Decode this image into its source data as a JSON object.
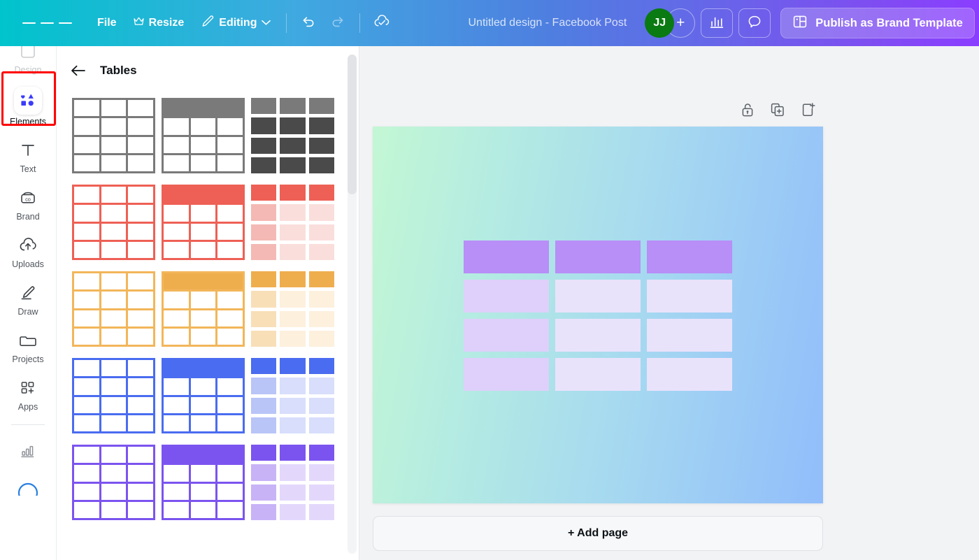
{
  "topbar": {
    "menu_icon": "hamburger-icon",
    "file_label": "File",
    "resize_label": "Resize",
    "resize_icon": "crown-icon",
    "editing_label": "Editing",
    "editing_icon": "pencil-icon",
    "chevron_icon": "chevron-down-icon",
    "undo_icon": "undo-icon",
    "redo_icon": "redo-icon",
    "cloud_icon": "cloud-check-icon",
    "doc_title": "Untitled design - Facebook Post",
    "avatar_initials": "JJ",
    "avatar_color": "#0a7a12",
    "add_collaborator_label": "+",
    "insights_icon": "bar-chart-icon",
    "comment_icon": "comment-bubble-icon",
    "publish_icon": "brand-template-icon",
    "publish_label": "Publish as Brand Template"
  },
  "rail": {
    "items": [
      {
        "label": "Design",
        "icon": "design-icon",
        "active": false,
        "cut": true
      },
      {
        "label": "Elements",
        "icon": "elements-icon",
        "active": true,
        "highlighted": true
      },
      {
        "label": "Text",
        "icon": "text-icon",
        "active": false
      },
      {
        "label": "Brand",
        "icon": "brand-icon",
        "active": false
      },
      {
        "label": "Uploads",
        "icon": "uploads-icon",
        "active": false
      },
      {
        "label": "Draw",
        "icon": "draw-icon",
        "active": false
      },
      {
        "label": "Projects",
        "icon": "projects-icon",
        "active": false
      },
      {
        "label": "Apps",
        "icon": "apps-icon",
        "active": false
      }
    ],
    "footer_items": [
      {
        "label": "",
        "icon": "charts-icon"
      },
      {
        "label": "",
        "icon": "magic-circle-icon"
      }
    ],
    "highlight_color": "#ff0000"
  },
  "panel": {
    "back_icon": "back-arrow-icon",
    "title": "Tables",
    "colors": [
      {
        "name": "gray",
        "border": "#7a7a7a",
        "header": "#7a7a7a",
        "body_a": "#4a4a4a",
        "body_b": "#4a4a4a"
      },
      {
        "name": "red",
        "border": "#ee6055",
        "header": "#ee6055",
        "body_a": "#f4b9b4",
        "body_b": "#fadedc"
      },
      {
        "name": "orange",
        "border": "#f2b65a",
        "header": "#efae4e",
        "body_a": "#f8dfb8",
        "body_b": "#fdf0dd"
      },
      {
        "name": "blue",
        "border": "#4a6cf0",
        "header": "#4a6cf0",
        "body_a": "#b9c5f7",
        "body_b": "#d8deFB"
      },
      {
        "name": "purple",
        "border": "#7b54ef",
        "header": "#7b54ef",
        "body_a": "#c8b3f7",
        "body_b": "#e3d8fc"
      }
    ],
    "variants": [
      "outline-grid",
      "filled-header-grid",
      "separated-cells"
    ]
  },
  "editor": {
    "page_tools": [
      {
        "icon": "unlock-icon",
        "label": "Lock"
      },
      {
        "icon": "duplicate-icon",
        "label": "Duplicate page"
      },
      {
        "icon": "add-page-icon",
        "label": "Add page"
      }
    ],
    "canvas": {
      "gradient_from": "#c3f7d4",
      "gradient_to": "#91bdfb",
      "table": {
        "rows": 4,
        "cols": 3,
        "header_color": "#b88ef7",
        "cells": [
          [
            "#b88ef7",
            "#b88ef7",
            "#b88ef7"
          ],
          [
            "#ded0fa",
            "#e9e2fb",
            "#e9e2fb"
          ],
          [
            "#ded0fa",
            "#e9e2fb",
            "#e9e2fb"
          ],
          [
            "#ded0fa",
            "#e9e2fb",
            "#e9e2fb"
          ]
        ]
      }
    },
    "add_page_label": "+ Add page"
  }
}
